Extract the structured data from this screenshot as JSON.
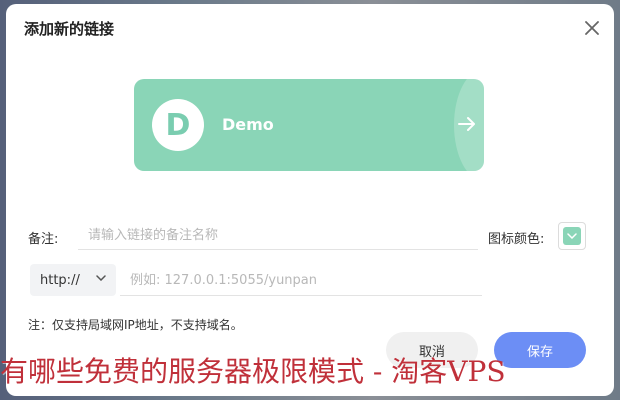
{
  "dialog": {
    "title": "添加新的链接",
    "close_icon": "close-icon"
  },
  "preview": {
    "initial": "D",
    "name": "Demo",
    "background": "#8ad5b7",
    "arrow_icon": "arrow-right-icon"
  },
  "form": {
    "note_label": "备注:",
    "note_placeholder": "请输入链接的备注名称",
    "note_value": "",
    "color_label": "图标颜色:",
    "color_value": "#8ad5b7",
    "protocol_value": "http://",
    "address_placeholder": "例如: 127.0.0.1:5055/yunpan",
    "address_value": "",
    "hint": "注：仅支持局域网IP地址，不支持域名。"
  },
  "buttons": {
    "cancel_label": "取消",
    "save_label": "保存"
  },
  "colors": {
    "accent": "#6c8ef5",
    "card": "#8ad5b7",
    "watermark": "#c0303a"
  },
  "watermark": {
    "text": "有哪些免费的服务器极限模式 - 淘客VPS"
  }
}
